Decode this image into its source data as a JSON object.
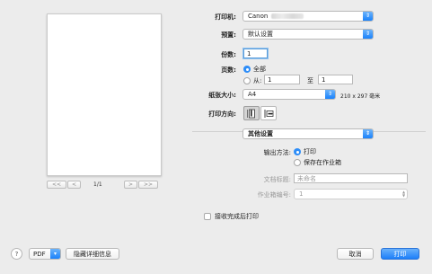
{
  "preview": {
    "first_label": "<<",
    "prev_label": "<",
    "page_indicator": "1/1",
    "next_label": ">",
    "last_label": ">>"
  },
  "printer": {
    "label": "打印机:",
    "value": "Canon"
  },
  "preset": {
    "label": "预置:",
    "value": "默认设置"
  },
  "copies": {
    "label": "份数:",
    "value": "1"
  },
  "pages": {
    "label": "页数:",
    "all_label": "全部",
    "from_label": "从:",
    "from_value": "1",
    "to_label": "至",
    "to_value": "1",
    "selected": "all"
  },
  "paper_size": {
    "label": "纸张大小:",
    "value": "A4",
    "dimensions": "210 x 297 毫米"
  },
  "orientation": {
    "label": "打印方向:",
    "selected": "portrait"
  },
  "section_menu": {
    "value": "其他设置"
  },
  "output": {
    "label": "输出方法:",
    "print_label": "打印",
    "save_label": "保存在作业箱",
    "selected": "print"
  },
  "doc_title": {
    "label": "文档标题:",
    "placeholder": "未命名"
  },
  "job_box": {
    "label": "作业箱编号:",
    "value": "1"
  },
  "print_on_complete": {
    "label": "接收完成后打印",
    "checked": false
  },
  "footer": {
    "help_label": "?",
    "pdf_label": "PDF",
    "hide_details_label": "隐藏详细信息",
    "cancel_label": "取消",
    "print_label": "打印"
  },
  "colors": {
    "accent": "#1c7ff9",
    "background": "#ececec"
  }
}
